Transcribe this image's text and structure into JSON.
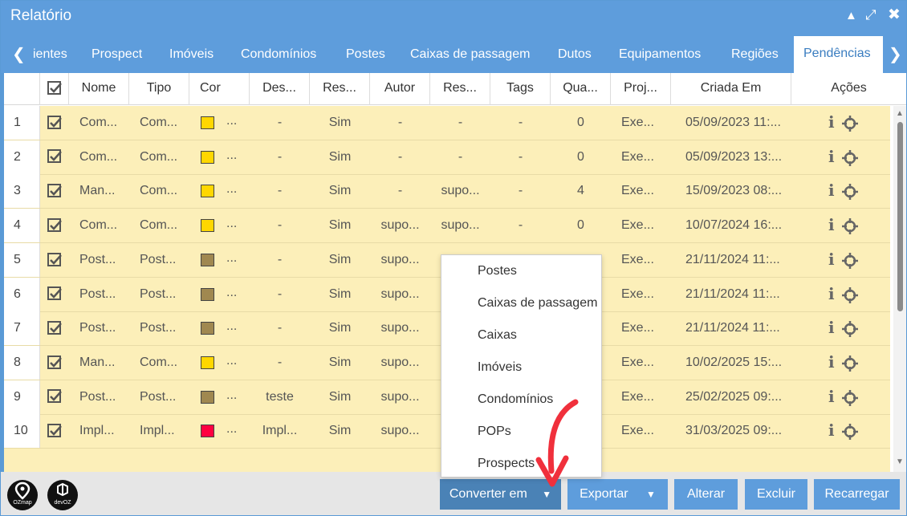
{
  "window": {
    "title": "Relatório"
  },
  "tabs": [
    {
      "label": "ientes"
    },
    {
      "label": "Prospect"
    },
    {
      "label": "Imóveis"
    },
    {
      "label": "Condomínios"
    },
    {
      "label": "Postes"
    },
    {
      "label": "Caixas de passagem"
    },
    {
      "label": "Dutos"
    },
    {
      "label": "Equipamentos"
    },
    {
      "label": "Regiões"
    },
    {
      "label": "Pendências"
    }
  ],
  "columns": [
    "Nome",
    "Tipo",
    "Cor",
    "Des...",
    "Res...",
    "Autor",
    "Res...",
    "Tags",
    "Qua...",
    "Proj...",
    "Criada Em",
    "Ações"
  ],
  "colors": {
    "yellow": "#ffd700",
    "olive": "#a08850",
    "red": "#ff0040",
    "accent": "#5e9ddc",
    "row_bg": "#fcefb9"
  },
  "rows": [
    {
      "n": "1",
      "nome": "Com...",
      "tipo": "Com...",
      "cor": "#ffd700",
      "des": "-",
      "res": "Sim",
      "autor": "-",
      "res2": "-",
      "tags": "-",
      "qua": "0",
      "proj": "Exe...",
      "criada": "05/09/2023 11:..."
    },
    {
      "n": "2",
      "nome": "Com...",
      "tipo": "Com...",
      "cor": "#ffd700",
      "des": "-",
      "res": "Sim",
      "autor": "-",
      "res2": "-",
      "tags": "-",
      "qua": "0",
      "proj": "Exe...",
      "criada": "05/09/2023 13:..."
    },
    {
      "n": "3",
      "nome": "Man...",
      "tipo": "Com...",
      "cor": "#ffd700",
      "des": "-",
      "res": "Sim",
      "autor": "-",
      "res2": "supo...",
      "tags": "-",
      "qua": "4",
      "proj": "Exe...",
      "criada": "15/09/2023 08:..."
    },
    {
      "n": "4",
      "nome": "Com...",
      "tipo": "Com...",
      "cor": "#ffd700",
      "des": "-",
      "res": "Sim",
      "autor": "supo...",
      "res2": "supo...",
      "tags": "-",
      "qua": "0",
      "proj": "Exe...",
      "criada": "10/07/2024 16:..."
    },
    {
      "n": "5",
      "nome": "Post...",
      "tipo": "Post...",
      "cor": "#a08850",
      "des": "-",
      "res": "Sim",
      "autor": "supo...",
      "res2": "",
      "tags": "",
      "qua": "",
      "proj": "Exe...",
      "criada": "21/11/2024 11:..."
    },
    {
      "n": "6",
      "nome": "Post...",
      "tipo": "Post...",
      "cor": "#a08850",
      "des": "-",
      "res": "Sim",
      "autor": "supo...",
      "res2": "",
      "tags": "",
      "qua": "",
      "proj": "Exe...",
      "criada": "21/11/2024 11:..."
    },
    {
      "n": "7",
      "nome": "Post...",
      "tipo": "Post...",
      "cor": "#a08850",
      "des": "-",
      "res": "Sim",
      "autor": "supo...",
      "res2": "",
      "tags": "",
      "qua": "",
      "proj": "Exe...",
      "criada": "21/11/2024 11:..."
    },
    {
      "n": "8",
      "nome": "Man...",
      "tipo": "Com...",
      "cor": "#ffd700",
      "des": "-",
      "res": "Sim",
      "autor": "supo...",
      "res2": "",
      "tags": "",
      "qua": "",
      "proj": "Exe...",
      "criada": "10/02/2025 15:..."
    },
    {
      "n": "9",
      "nome": "Post...",
      "tipo": "Post...",
      "cor": "#a08850",
      "des": "teste",
      "res": "Sim",
      "autor": "supo...",
      "res2": "",
      "tags": "",
      "qua": "",
      "proj": "Exe...",
      "criada": "25/02/2025 09:..."
    },
    {
      "n": "10",
      "nome": "Impl...",
      "tipo": "Impl...",
      "cor": "#ff0040",
      "des": "Impl...",
      "res": "Sim",
      "autor": "supo...",
      "res2": "",
      "tags": "",
      "qua": "",
      "proj": "Exe...",
      "criada": "31/03/2025 09:..."
    }
  ],
  "dropdown": {
    "items": [
      "Postes",
      "Caixas de passagem",
      "Caixas",
      "Imóveis",
      "Condomínios",
      "POPs",
      "Prospects"
    ]
  },
  "footer": {
    "logo1": "OZmap",
    "logo2": "devOZ",
    "convert_label": "Converter em",
    "export_label": "Exportar",
    "edit_label": "Alterar",
    "delete_label": "Excluir",
    "reload_label": "Recarregar"
  },
  "icons": {
    "minimize": "caret-up-icon",
    "maximize": "expand-icon",
    "close": "close-icon",
    "info": "info-icon",
    "locate": "crosshair-icon",
    "check": "checkbox-checked-icon"
  }
}
